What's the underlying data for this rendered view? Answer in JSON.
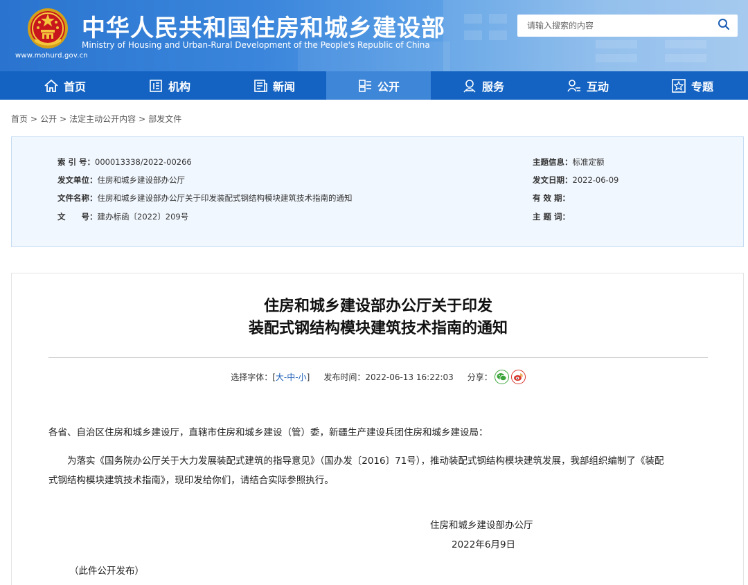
{
  "header": {
    "title_cn": "中华人民共和国住房和城乡建设部",
    "title_en": "Ministry of Housing and Urban-Rural Development of the People's Republic of China",
    "url": "www.mohurd.gov.cn",
    "brand_color": "#1463c2",
    "search": {
      "placeholder": "请输入搜索的内容",
      "icon": "search-icon"
    }
  },
  "nav": {
    "items": [
      {
        "label": "首页",
        "icon": "home-icon"
      },
      {
        "label": "机构",
        "icon": "organization-icon"
      },
      {
        "label": "新闻",
        "icon": "news-icon"
      },
      {
        "label": "公开",
        "icon": "disclosure-icon",
        "active": true
      },
      {
        "label": "服务",
        "icon": "service-icon"
      },
      {
        "label": "互动",
        "icon": "interaction-icon"
      },
      {
        "label": "专题",
        "icon": "topic-icon"
      }
    ]
  },
  "breadcrumb": {
    "items": [
      "首页",
      "公开",
      "法定主动公开内容",
      "部发文件"
    ],
    "separator": ">"
  },
  "meta": {
    "index_label": "索 引 号：",
    "index_value": "000013338/2022-00266",
    "issuer_label": "发文单位：",
    "issuer_value": "住房和城乡建设部办公厅",
    "filename_label": "文件名称：",
    "filename_value": "住房和城乡建设部办公厅关于印发装配式钢结构模块建筑技术指南的通知",
    "docno_label": "文　　号：",
    "docno_value": "建办标函〔2022〕209号",
    "topic_label": "主题信息：",
    "topic_value": "标准定额",
    "date_label": "发文日期：",
    "date_value": "2022-06-09",
    "validity_label": "有 效 期：",
    "validity_value": "",
    "keywords_label": "主 题 词：",
    "keywords_value": ""
  },
  "article": {
    "title_line1": "住房和城乡建设部办公厅关于印发",
    "title_line2": "装配式钢结构模块建筑技术指南的通知",
    "font_label": "选择字体：[",
    "font_large": "大",
    "font_medium": "中",
    "font_small": "小",
    "font_end": "]",
    "dash": "-",
    "publish_label": "发布时间：",
    "publish_time": "2022-06-13 16:22:03",
    "share_label": "分享：",
    "salutation": "各省、自治区住房和城乡建设厅，直辖市住房和城乡建设（管）委，新疆生产建设兵团住房和城乡建设局：",
    "para1_line1": "为落实《国务院办公厅关于大力发展装配式建筑的指导意见》（国办发〔2016〕71号），推动装配式钢结构模块建筑发展，我部组织编制了《装配",
    "para1_line2": "式钢结构模块建筑技术指南》，现印发给你们，请结合实际参照执行。",
    "signer": "住房和城乡建设部办公厅",
    "sign_date": "2022年6月9日",
    "public_note": "（此件公开发布）"
  }
}
